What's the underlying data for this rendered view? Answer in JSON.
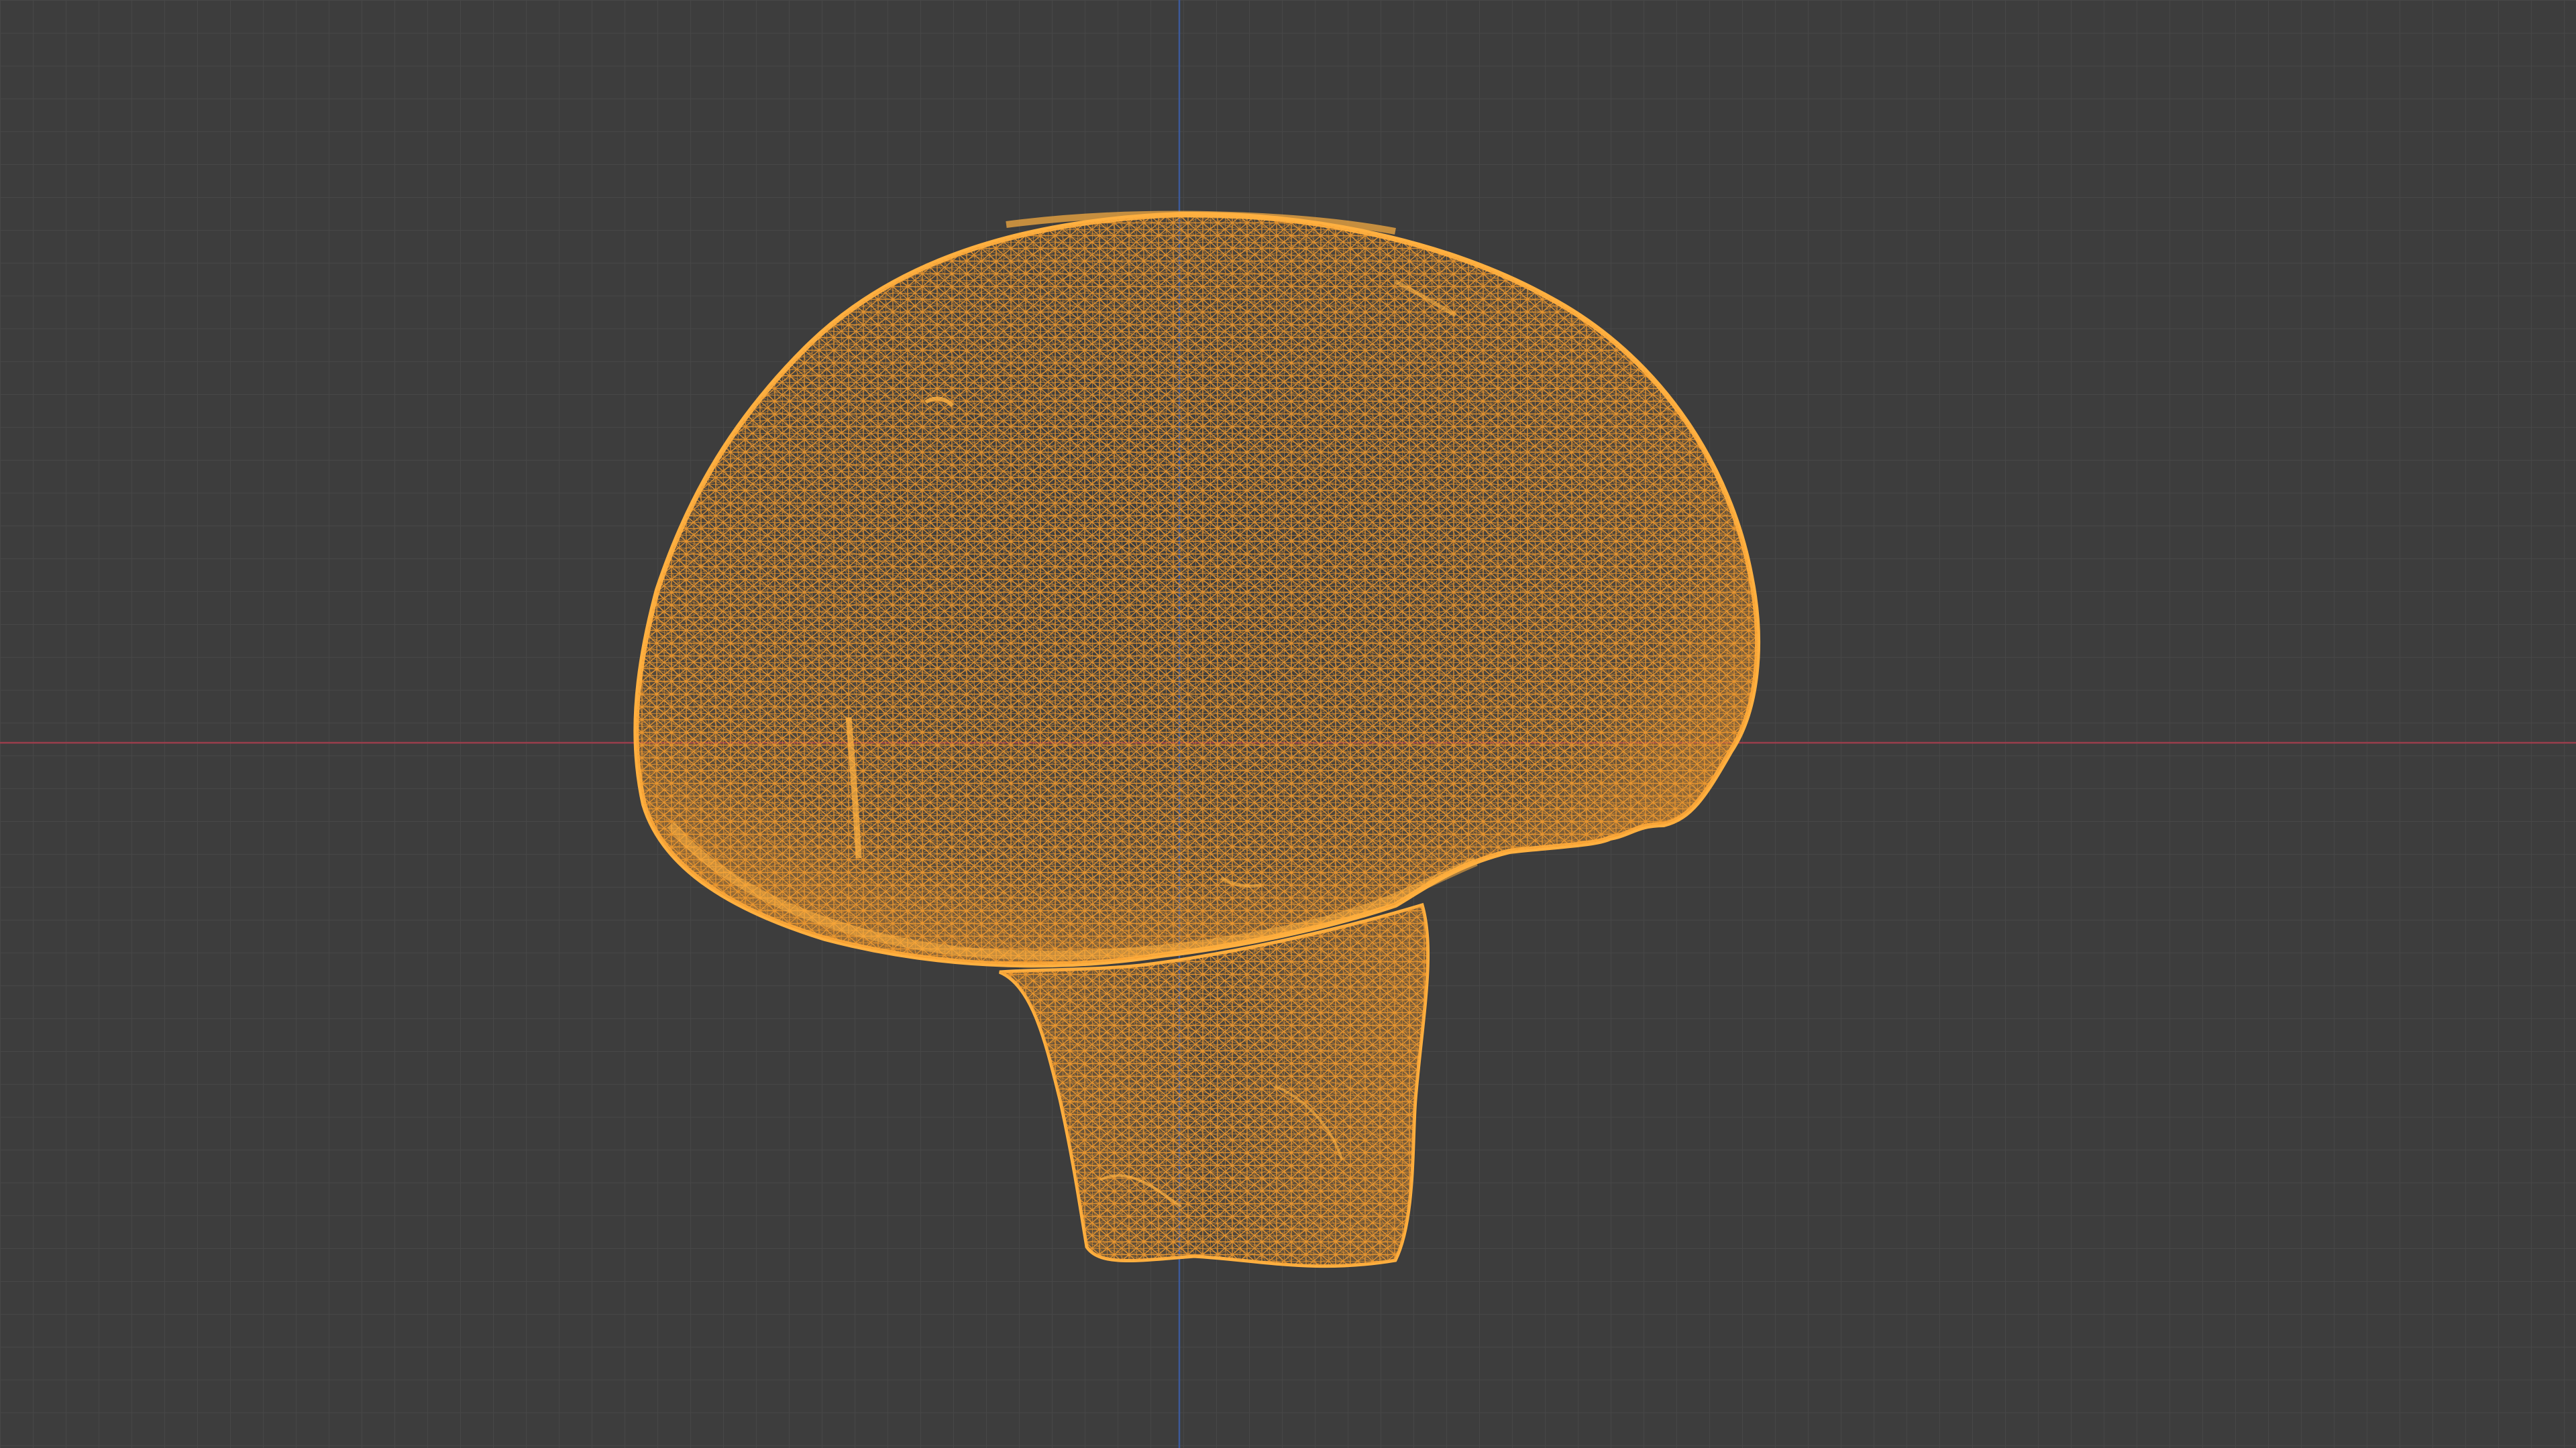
{
  "viewport": {
    "mode": "wireframe",
    "view": "front-orthographic",
    "object": "mushroom-mesh",
    "selected": true
  },
  "colors": {
    "background": "#3d3d3d",
    "grid_minor": "#474747",
    "grid_major": "#515151",
    "x_axis": "#9b3e4c",
    "z_axis": "#3d5a9a",
    "wire_selected": "#f29a2e",
    "wire_outline": "#ffb040"
  }
}
